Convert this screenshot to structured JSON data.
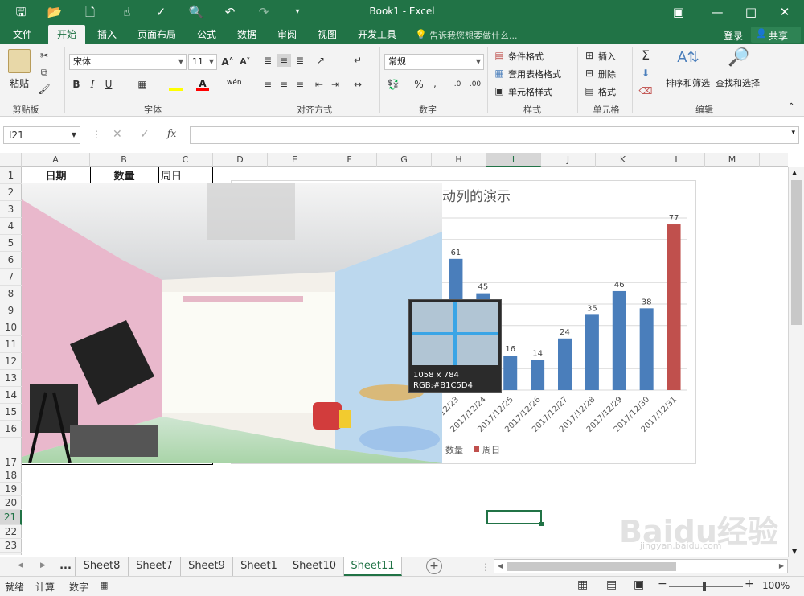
{
  "window": {
    "title": "Book1 - Excel"
  },
  "qat": {
    "save": "save-icon",
    "open": "open-icon",
    "new": "new-icon",
    "touch": "touch-icon",
    "spell": "spellcheck-icon",
    "preview": "preview-icon",
    "undo": "undo-icon",
    "redo": "redo-icon",
    "customize": "customize-icon"
  },
  "menu": {
    "tabs": [
      "文件",
      "开始",
      "插入",
      "页面布局",
      "公式",
      "数据",
      "审阅",
      "视图",
      "开发工具"
    ],
    "tellme": "告诉我您想要做什么...",
    "login": "登录",
    "share": "共享"
  },
  "ribbon": {
    "clipboard": {
      "paste": "粘贴",
      "label": "剪贴板"
    },
    "font": {
      "name": "宋体",
      "size": "11",
      "label": "字体",
      "bold": "B",
      "italic": "I",
      "underline": "U",
      "phonetic": "wén"
    },
    "align": {
      "label": "对齐方式"
    },
    "number": {
      "format": "常规",
      "label": "数字",
      "percent": "%"
    },
    "styles": {
      "cond": "条件格式",
      "table": "套用表格格式",
      "cell": "单元格样式",
      "label": "样式"
    },
    "cells": {
      "insert": "插入",
      "delete": "删除",
      "format": "格式",
      "label": "单元格"
    },
    "editing": {
      "sort": "排序和筛选",
      "find": "查找和选择",
      "label": "编辑"
    }
  },
  "formula_bar": {
    "name_box": "I21",
    "fx": "fx"
  },
  "columns": [
    "A",
    "B",
    "C",
    "D",
    "E",
    "F",
    "G",
    "H",
    "I",
    "J",
    "K",
    "L",
    "M"
  ],
  "rows": [
    "1",
    "2",
    "3",
    "4",
    "5",
    "6",
    "7",
    "8",
    "9",
    "10",
    "11",
    "12",
    "13",
    "14",
    "15",
    "16",
    "17",
    "18",
    "19",
    "20",
    "21",
    "22",
    "23"
  ],
  "table_headers": {
    "a": "日期",
    "b": "数量",
    "c": "周日"
  },
  "chart_data": {
    "type": "bar",
    "title_fragment": "动列的演示",
    "categories": [
      "2017/12/23",
      "2017/12/24",
      "2017/12/25",
      "2017/12/26",
      "2017/12/27",
      "2017/12/28",
      "2017/12/29",
      "2017/12/30",
      "2017/12/31"
    ],
    "series": [
      {
        "name": "数量",
        "color": "#4a7ebb",
        "values": [
          61,
          45,
          16,
          14,
          24,
          35,
          46,
          38,
          null
        ]
      },
      {
        "name": "周日",
        "color": "#c0504d",
        "values": [
          null,
          null,
          null,
          null,
          null,
          null,
          null,
          null,
          77
        ]
      }
    ],
    "ylim": [
      0,
      80
    ],
    "grid": true,
    "legend": "bottom"
  },
  "magnifier": {
    "size": "1058 x 784",
    "rgb": "RGB:#B1C5D4"
  },
  "sheets": {
    "more": "...",
    "tabs": [
      "Sheet8",
      "Sheet7",
      "Sheet9",
      "Sheet1",
      "Sheet10",
      "Sheet11"
    ],
    "active": "Sheet11"
  },
  "status": {
    "ready": "就绪",
    "calc": "计算",
    "digits": "数字",
    "zoom": "100%"
  },
  "watermark": {
    "text": "Baidu经验",
    "url": "jingyan.baidu.com"
  }
}
